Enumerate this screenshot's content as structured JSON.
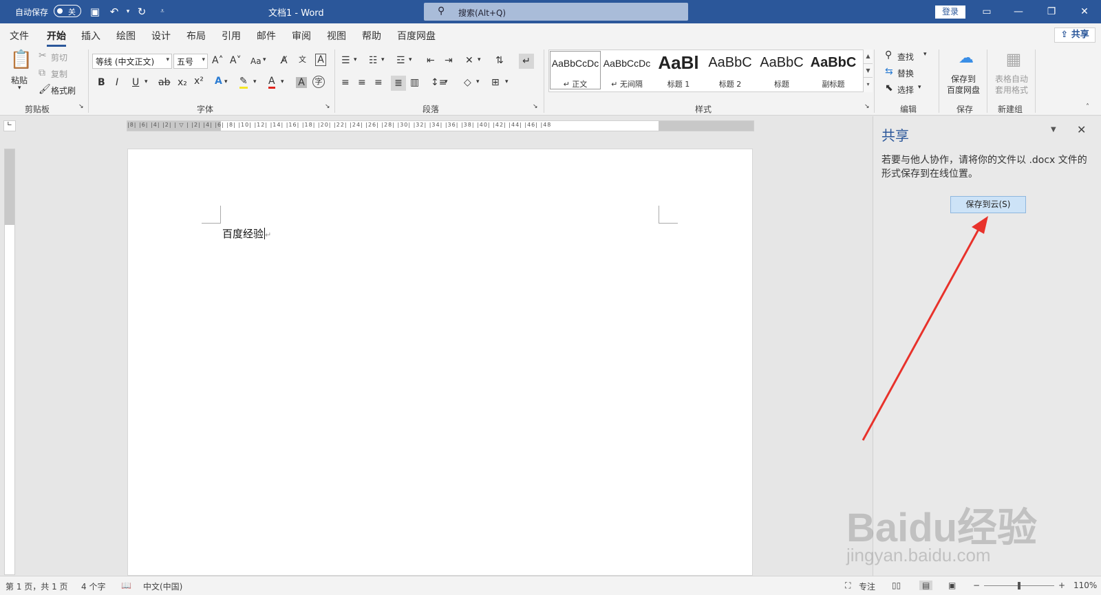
{
  "titlebar": {
    "autosave_label": "自动保存",
    "autosave_state": "关",
    "doc_title": "文档1 - Word",
    "search_placeholder": "搜索(Alt+Q)",
    "login_label": "登录"
  },
  "menu": {
    "tabs": [
      "文件",
      "开始",
      "插入",
      "绘图",
      "设计",
      "布局",
      "引用",
      "邮件",
      "审阅",
      "视图",
      "帮助",
      "百度网盘"
    ],
    "active_tab": "开始",
    "share_label": "共享"
  },
  "ribbon": {
    "clipboard": {
      "paste": "粘贴",
      "cut": "剪切",
      "copy": "复制",
      "format_painter": "格式刷",
      "label": "剪贴板"
    },
    "font": {
      "font_name": "等线 (中文正文)",
      "font_size": "五号",
      "change_case": "Aa",
      "label": "字体"
    },
    "paragraph": {
      "label": "段落"
    },
    "styles": {
      "label": "样式",
      "items": [
        {
          "sample": "AaBbCcDc",
          "name": "↵ 正文"
        },
        {
          "sample": "AaBbCcDc",
          "name": "↵ 无间隔"
        },
        {
          "sample": "AaBl",
          "name": "标题 1"
        },
        {
          "sample": "AaBbC",
          "name": "标题 2"
        },
        {
          "sample": "AaBbC",
          "name": "标题"
        },
        {
          "sample": "AaBbC",
          "name": "副标题"
        }
      ]
    },
    "editing": {
      "find": "查找",
      "replace": "替换",
      "select": "选择",
      "label": "编辑"
    },
    "save": {
      "save_to_line1": "保存到",
      "save_to_line2": "百度网盘",
      "label": "保存"
    },
    "newgroup": {
      "line1": "表格自动",
      "line2": "套用格式",
      "label": "新建组"
    }
  },
  "ruler": {
    "ticks": "|8| |6| |4| |2| | ▽ | |2| |4| |6| |8| |10| |12| |14| |16| |18| |20| |22| |24| |26| |28| |30| |32| |34| |36| |38| |40| |42| |44| |46| |48"
  },
  "document": {
    "text": "百度经验"
  },
  "share_pane": {
    "title": "共享",
    "description": "若要与他人协作，请将你的文件以 .docx 文件的形式保存到在线位置。",
    "save_cloud_button": "保存到云(S)"
  },
  "statusbar": {
    "page": "第 1 页，共 1 页",
    "words": "4 个字",
    "language": "中文(中国)",
    "focus": "专注",
    "zoom": "110%"
  },
  "watermark": {
    "logo": "Baidu经验",
    "url": "jingyan.baidu.com"
  },
  "colors": {
    "brand": "#2b579a",
    "arrow": "#e8322b"
  }
}
